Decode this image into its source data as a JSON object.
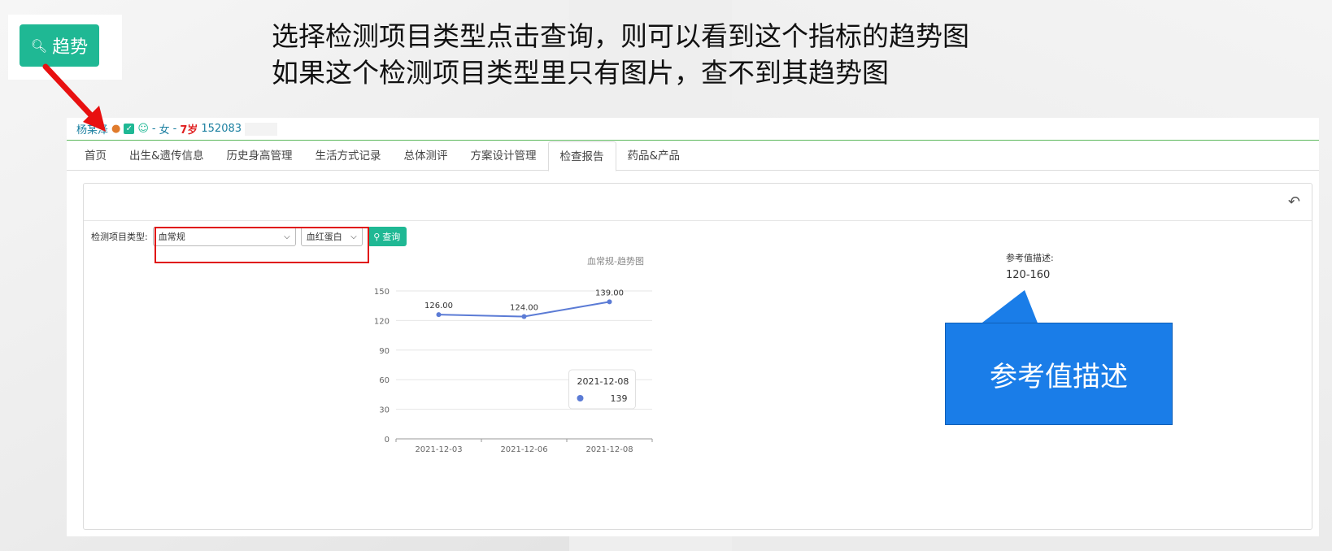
{
  "annotation": {
    "trend_button_label": "趋势",
    "headline_line1": "选择检测项目类型点击查询，则可以看到这个指标的趋势图",
    "headline_line2": "如果这个检测项目类型里只有图片，查不到其趋势图",
    "callout_text": "参考值描述"
  },
  "patient": {
    "name": "杨某泽",
    "gender_sep1": "-",
    "gender": "女",
    "gender_sep2": "-",
    "age": "7岁",
    "id": "152083"
  },
  "tabs": [
    {
      "label": "首页"
    },
    {
      "label": "出生&遗传信息"
    },
    {
      "label": "历史身高管理"
    },
    {
      "label": "生活方式记录"
    },
    {
      "label": "总体测评"
    },
    {
      "label": "方案设计管理"
    },
    {
      "label": "检查报告",
      "active": true
    },
    {
      "label": "药品&产品"
    }
  ],
  "filter": {
    "label": "检测项目类型:",
    "category_value": "血常规",
    "item_value": "血红蛋白",
    "query_label": "查询"
  },
  "reference": {
    "title": "参考值描述:",
    "value": "120-160"
  },
  "chart_data": {
    "type": "line",
    "title": "血常规-趋势图",
    "categories": [
      "2021-12-03",
      "2021-12-06",
      "2021-12-08"
    ],
    "series": [
      {
        "values": [
          126.0,
          124.0,
          139.0
        ],
        "labels": [
          "126.00",
          "124.00",
          "139.00"
        ]
      }
    ],
    "ylim": [
      0,
      150
    ],
    "yticks": [
      0,
      30,
      60,
      90,
      120,
      150
    ],
    "grid": true,
    "tooltip": {
      "date": "2021-12-08",
      "value": "139"
    },
    "colors": {
      "line": "#5b7bd5",
      "grid": "#e6e6e6"
    }
  },
  "colors": {
    "accent": "#1fb894",
    "highlight_frame": "#e01010",
    "callout": "#1a7de8",
    "arrow": "#e81010"
  }
}
